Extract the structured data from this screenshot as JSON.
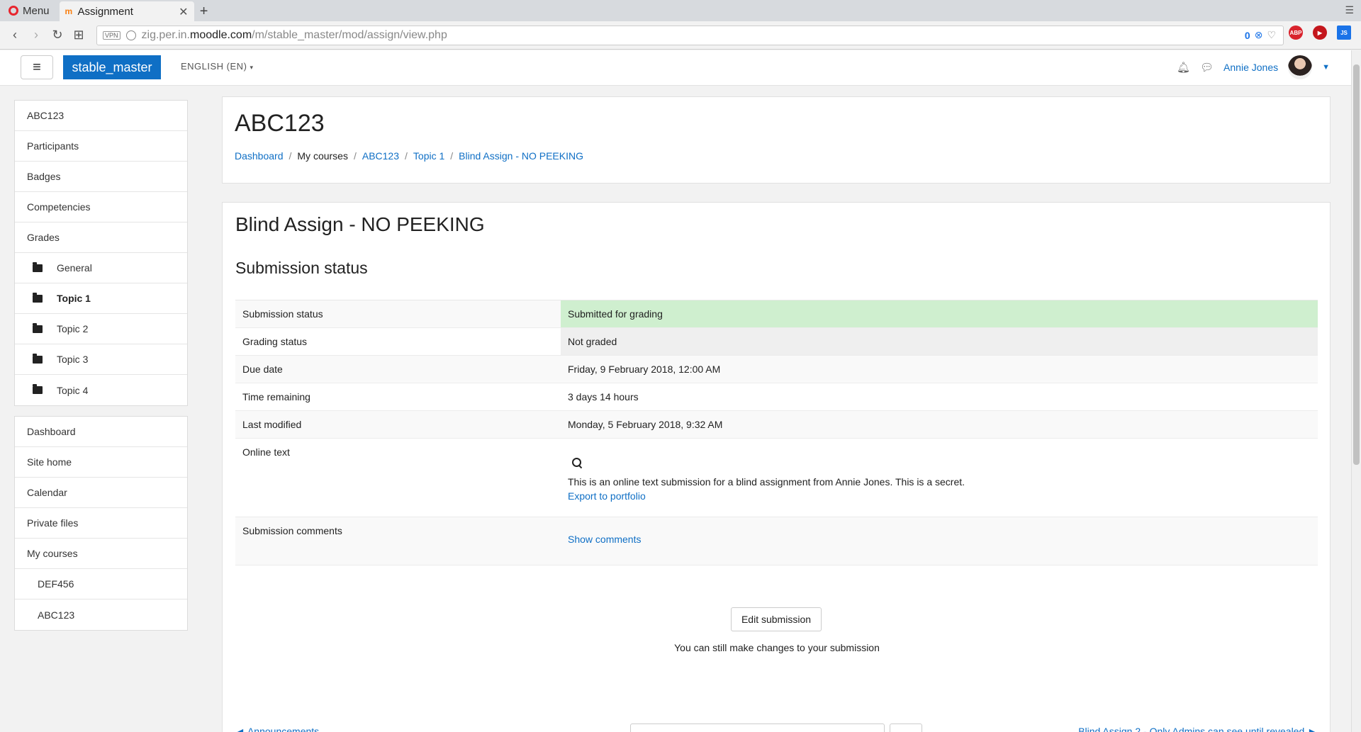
{
  "browser": {
    "menu_label": "Menu",
    "tab_title": "Assignment",
    "url_prefix": "zig.per.in.",
    "url_domain": "moodle.com",
    "url_path": "/m/stable_master/mod/assign/view.php",
    "vpn_label": "VPN",
    "blocker_count": "0",
    "ext_abp": "ABP",
    "ext_js": "JS"
  },
  "navbar": {
    "brand": "stable_master",
    "language": "ENGLISH (EN)",
    "user_name": "Annie Jones"
  },
  "drawer": {
    "course_items": [
      {
        "label": "ABC123"
      },
      {
        "label": "Participants"
      },
      {
        "label": "Badges"
      },
      {
        "label": "Competencies"
      },
      {
        "label": "Grades"
      }
    ],
    "topics": [
      {
        "label": "General"
      },
      {
        "label": "Topic 1"
      },
      {
        "label": "Topic 2"
      },
      {
        "label": "Topic 3"
      },
      {
        "label": "Topic 4"
      }
    ],
    "site_items": [
      {
        "label": "Dashboard"
      },
      {
        "label": "Site home"
      },
      {
        "label": "Calendar"
      },
      {
        "label": "Private files"
      },
      {
        "label": "My courses"
      }
    ],
    "my_courses": [
      {
        "label": "DEF456"
      },
      {
        "label": "ABC123"
      }
    ]
  },
  "header": {
    "course_title": "ABC123",
    "breadcrumb": [
      "Dashboard",
      "My courses",
      "ABC123",
      "Topic 1",
      "Blind Assign - NO PEEKING"
    ]
  },
  "assignment": {
    "title": "Blind Assign - NO PEEKING",
    "section_title": "Submission status",
    "rows": {
      "submission_status": {
        "label": "Submission status",
        "value": "Submitted for grading"
      },
      "grading_status": {
        "label": "Grading status",
        "value": "Not graded"
      },
      "due_date": {
        "label": "Due date",
        "value": "Friday, 9 February 2018, 12:00 AM"
      },
      "time_remaining": {
        "label": "Time remaining",
        "value": "3 days 14 hours"
      },
      "last_modified": {
        "label": "Last modified",
        "value": "Monday, 5 February 2018, 9:32 AM"
      },
      "online_text": {
        "label": "Online text",
        "value": "This is an online text submission for a blind assignment from Annie Jones. This is a secret.",
        "export_link": "Export to portfolio"
      },
      "submission_comments": {
        "label": "Submission comments",
        "link": "Show comments"
      }
    },
    "edit_button": "Edit submission",
    "edit_note": "You can still make changes to your submission",
    "prev_link": "◄ Announcements",
    "next_link": "Blind Assign 2 - Only Admins can see until revealed ►"
  },
  "colors": {
    "brand": "#0f6fc5",
    "link": "#0f6fc5",
    "submitted_bg": "#cfefcf",
    "not_graded_bg": "#efefef"
  }
}
